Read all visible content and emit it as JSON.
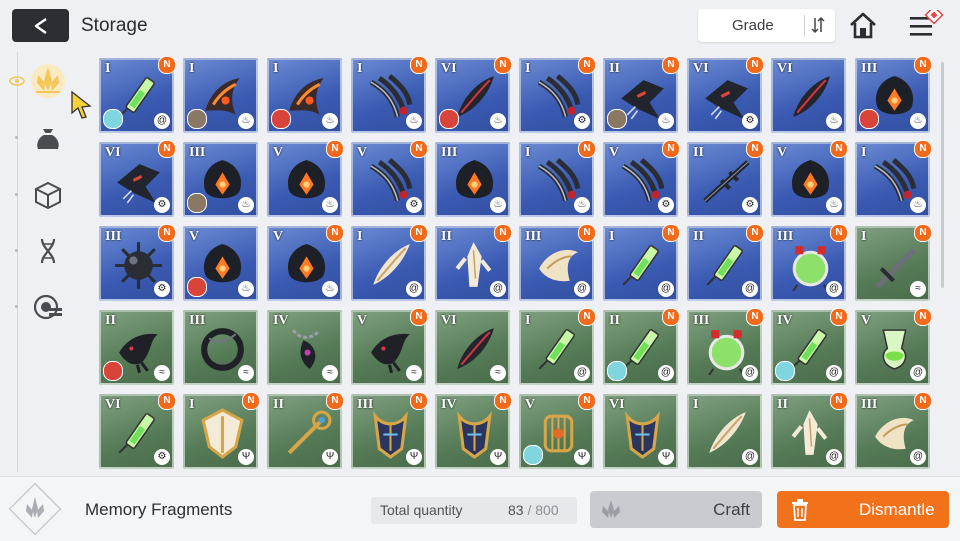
{
  "header": {
    "title": "Storage",
    "sort_label": "Grade"
  },
  "sidebar": {
    "items": [
      {
        "icon": "memory-fragment-icon",
        "active": true
      },
      {
        "icon": "pouch-icon",
        "active": false
      },
      {
        "icon": "cube-icon",
        "active": false
      },
      {
        "icon": "dna-icon",
        "active": false
      },
      {
        "icon": "chip-icon",
        "active": false
      }
    ]
  },
  "colors": {
    "accent": "#f2721c",
    "blue_card": "#3a5ab3",
    "green_card": "#557a56",
    "active_tab": "#f4c65a",
    "new_badge": "#f26a1b"
  },
  "grid": {
    "rows": [
      [
        {
          "grade": "I",
          "tier": "blue",
          "new": true,
          "art": "syringe",
          "avatar": "teal",
          "element": "water"
        },
        {
          "grade": "I",
          "tier": "blue",
          "new": false,
          "art": "flame-claw",
          "avatar": "brown",
          "element": "fire"
        },
        {
          "grade": "I",
          "tier": "blue",
          "new": false,
          "art": "flame-claw",
          "avatar": "red",
          "element": "fire"
        },
        {
          "grade": "I",
          "tier": "blue",
          "new": true,
          "art": "dark-claw",
          "avatar": "",
          "element": "fire"
        },
        {
          "grade": "VI",
          "tier": "blue",
          "new": true,
          "art": "dark-feather",
          "avatar": "red",
          "element": "fire"
        },
        {
          "grade": "I",
          "tier": "blue",
          "new": true,
          "art": "dark-claw",
          "avatar": "",
          "element": "tech"
        },
        {
          "grade": "II",
          "tier": "blue",
          "new": true,
          "art": "dark-shard",
          "avatar": "brown",
          "element": "fire"
        },
        {
          "grade": "VI",
          "tier": "blue",
          "new": true,
          "art": "dark-shard",
          "avatar": "",
          "element": "tech"
        },
        {
          "grade": "VI",
          "tier": "blue",
          "new": false,
          "art": "dark-feather",
          "avatar": "",
          "element": "fire"
        },
        {
          "grade": "III",
          "tier": "blue",
          "new": true,
          "art": "ember-pod",
          "avatar": "red",
          "element": "fire"
        }
      ],
      [
        {
          "grade": "VI",
          "tier": "blue",
          "new": true,
          "art": "dark-shard",
          "avatar": "",
          "element": "tech"
        },
        {
          "grade": "III",
          "tier": "blue",
          "new": false,
          "art": "ember-pod",
          "avatar": "brown",
          "element": "fire"
        },
        {
          "grade": "V",
          "tier": "blue",
          "new": true,
          "art": "ember-pod",
          "avatar": "",
          "element": "fire"
        },
        {
          "grade": "V",
          "tier": "blue",
          "new": true,
          "art": "dark-claw",
          "avatar": "",
          "element": "tech"
        },
        {
          "grade": "III",
          "tier": "blue",
          "new": false,
          "art": "ember-pod",
          "avatar": "",
          "element": "fire"
        },
        {
          "grade": "I",
          "tier": "blue",
          "new": true,
          "art": "dark-claw",
          "avatar": "",
          "element": "fire"
        },
        {
          "grade": "V",
          "tier": "blue",
          "new": true,
          "art": "dark-claw",
          "avatar": "",
          "element": "tech"
        },
        {
          "grade": "II",
          "tier": "blue",
          "new": true,
          "art": "dark-spear",
          "avatar": "",
          "element": "tech"
        },
        {
          "grade": "V",
          "tier": "blue",
          "new": true,
          "art": "ember-pod",
          "avatar": "",
          "element": "fire"
        },
        {
          "grade": "I",
          "tier": "blue",
          "new": true,
          "art": "dark-claw",
          "avatar": "",
          "element": "fire"
        }
      ],
      [
        {
          "grade": "III",
          "tier": "blue",
          "new": true,
          "art": "spiked-mine",
          "avatar": "",
          "element": "tech"
        },
        {
          "grade": "V",
          "tier": "blue",
          "new": false,
          "art": "ember-pod",
          "avatar": "red",
          "element": "fire"
        },
        {
          "grade": "V",
          "tier": "blue",
          "new": true,
          "art": "ember-pod",
          "avatar": "",
          "element": "fire"
        },
        {
          "grade": "I",
          "tier": "blue",
          "new": true,
          "art": "bone-feather",
          "avatar": "",
          "element": "water"
        },
        {
          "grade": "II",
          "tier": "blue",
          "new": true,
          "art": "bone-shard",
          "avatar": "",
          "element": "water"
        },
        {
          "grade": "III",
          "tier": "blue",
          "new": true,
          "art": "bone-wing",
          "avatar": "",
          "element": "water"
        },
        {
          "grade": "I",
          "tier": "blue",
          "new": true,
          "art": "syringe",
          "avatar": "",
          "element": "water"
        },
        {
          "grade": "II",
          "tier": "blue",
          "new": true,
          "art": "syringe",
          "avatar": "",
          "element": "water"
        },
        {
          "grade": "III",
          "tier": "blue",
          "new": true,
          "art": "green-orb",
          "avatar": "",
          "element": "water"
        },
        {
          "grade": "I",
          "tier": "green",
          "new": true,
          "art": "gray-blade",
          "avatar": "",
          "element": "wind"
        }
      ],
      [
        {
          "grade": "II",
          "tier": "green",
          "new": false,
          "art": "black-bird",
          "avatar": "red",
          "element": "wind"
        },
        {
          "grade": "III",
          "tier": "green",
          "new": false,
          "art": "black-ring",
          "avatar": "",
          "element": "wind"
        },
        {
          "grade": "IV",
          "tier": "green",
          "new": false,
          "art": "chain-hook",
          "avatar": "",
          "element": "wind"
        },
        {
          "grade": "V",
          "tier": "green",
          "new": true,
          "art": "black-bird",
          "avatar": "",
          "element": "wind"
        },
        {
          "grade": "VI",
          "tier": "green",
          "new": false,
          "art": "dark-feather",
          "avatar": "",
          "element": "wind"
        },
        {
          "grade": "I",
          "tier": "green",
          "new": true,
          "art": "syringe",
          "avatar": "",
          "element": "water"
        },
        {
          "grade": "II",
          "tier": "green",
          "new": true,
          "art": "syringe",
          "avatar": "teal",
          "element": "water"
        },
        {
          "grade": "III",
          "tier": "green",
          "new": true,
          "art": "green-orb",
          "avatar": "",
          "element": "water"
        },
        {
          "grade": "IV",
          "tier": "green",
          "new": true,
          "art": "syringe",
          "avatar": "teal",
          "element": "water"
        },
        {
          "grade": "V",
          "tier": "green",
          "new": true,
          "art": "green-vial",
          "avatar": "",
          "element": "water"
        }
      ],
      [
        {
          "grade": "VI",
          "tier": "green",
          "new": true,
          "art": "syringe",
          "avatar": "",
          "element": "tech"
        },
        {
          "grade": "I",
          "tier": "green",
          "new": true,
          "art": "gold-shield",
          "avatar": "",
          "element": "earth"
        },
        {
          "grade": "II",
          "tier": "green",
          "new": true,
          "art": "gold-staff",
          "avatar": "",
          "element": "earth"
        },
        {
          "grade": "III",
          "tier": "green",
          "new": true,
          "art": "gold-crest",
          "avatar": "",
          "element": "earth"
        },
        {
          "grade": "IV",
          "tier": "green",
          "new": true,
          "art": "gold-crest",
          "avatar": "",
          "element": "earth"
        },
        {
          "grade": "V",
          "tier": "green",
          "new": true,
          "art": "gold-cage",
          "avatar": "teal",
          "element": "earth"
        },
        {
          "grade": "VI",
          "tier": "green",
          "new": false,
          "art": "gold-crest",
          "avatar": "",
          "element": "earth"
        },
        {
          "grade": "I",
          "tier": "green",
          "new": false,
          "art": "bone-feather",
          "avatar": "",
          "element": "water"
        },
        {
          "grade": "II",
          "tier": "green",
          "new": true,
          "art": "bone-shard",
          "avatar": "",
          "element": "water"
        },
        {
          "grade": "III",
          "tier": "green",
          "new": true,
          "art": "bone-wing",
          "avatar": "",
          "element": "water"
        }
      ]
    ],
    "new_badge_text": "N"
  },
  "footer": {
    "category_label": "Memory Fragments",
    "total_label": "Total quantity",
    "total_count": "83",
    "total_sep": " / ",
    "total_max": "800",
    "craft_label": "Craft",
    "dismantle_label": "Dismantle"
  }
}
